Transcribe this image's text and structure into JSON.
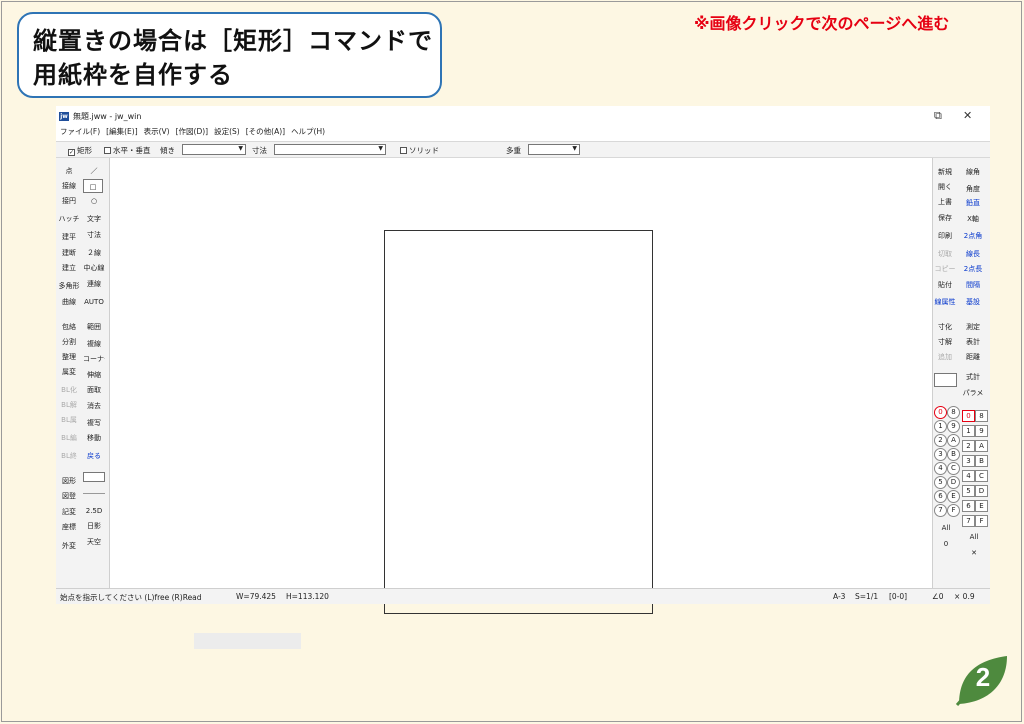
{
  "callout": {
    "line1": "縦置きの場合は［矩形］コマンドで",
    "line2": "用紙枠を自作する"
  },
  "notice": "※画像クリックで次のページへ進む",
  "window": {
    "title": "無題.jww - jw_win",
    "icon_label": "jw",
    "restore_label": "⧉",
    "close_label": "✕",
    "menu": [
      "ファイル(F)",
      "[編集(E)]",
      "表示(V)",
      "[作図(D)]",
      "設定(S)",
      "[その他(A)]",
      "ヘルプ(H)"
    ]
  },
  "cmdbar": {
    "rect_label": "矩形",
    "rect_checked": "✓",
    "hv_label": "水平・垂直",
    "angle_label": "傾き",
    "dim_label": "寸法",
    "solid_label": "ソリッド",
    "multi_label": "多重",
    "arrow": "▼"
  },
  "left_tools": [
    [
      "点",
      "／"
    ],
    [
      "接線",
      "□"
    ],
    [
      "接円",
      "○"
    ],
    [
      "ハッチ",
      "文字"
    ],
    [
      "建平",
      "寸法"
    ],
    [
      "建断",
      "２線"
    ],
    [
      "建立",
      "中心線"
    ],
    [
      "多角形",
      "連線"
    ],
    [
      "曲線",
      "AUTO"
    ],
    [
      "包絡",
      "範囲"
    ],
    [
      "分割",
      "複線"
    ],
    [
      "整理",
      "コーナー"
    ],
    [
      "属変",
      "伸縮"
    ],
    [
      "BL化",
      "面取"
    ],
    [
      "BL解",
      "消去"
    ],
    [
      "BL属",
      "複写"
    ],
    [
      "BL編",
      "移動"
    ],
    [
      "BL終",
      "戻る"
    ],
    [
      "図形",
      ""
    ],
    [
      "図登",
      ""
    ],
    [
      "記変",
      "2.5D"
    ],
    [
      "座標",
      "日影"
    ],
    [
      "外変",
      "天空"
    ]
  ],
  "right_tools": [
    [
      "新規",
      "寸化"
    ],
    [
      "開く",
      "寸解"
    ],
    [
      "上書",
      "追加"
    ],
    [
      "保存",
      ""
    ],
    [
      "印刷",
      ""
    ],
    [
      "切取",
      ""
    ],
    [
      "コピー",
      ""
    ],
    [
      "貼付",
      ""
    ],
    [
      "線属性",
      ""
    ]
  ],
  "right_tools_2": [
    "鉛直",
    "X軸",
    "2点角",
    "線長",
    "2点長",
    "間隔",
    "基設",
    "測定",
    "表計",
    "距離",
    "式計",
    "パラメ"
  ],
  "right_tools_2_head": [
    "線角",
    "角度"
  ],
  "layers": [
    "0",
    "1",
    "2",
    "3",
    "4",
    "5",
    "6",
    "7",
    "8",
    "9",
    "A",
    "B",
    "C",
    "D",
    "E",
    "F"
  ],
  "layer_all": "All",
  "layer_zero": "0",
  "group_all": "All",
  "group_x": "✕",
  "status": {
    "prompt": "始点を指示してください (L)free (R)Read",
    "w": "W=79.425",
    "h": "H=113.120",
    "paper": "A-3",
    "scale": "S=1/1",
    "layer": "[0-0]",
    "angle": "∠0",
    "factor": "× 0.9"
  },
  "page_number": "2",
  "colors": {
    "accent": "#2e74b5",
    "notice": "#e60012",
    "badge": "#4e8a3e"
  }
}
